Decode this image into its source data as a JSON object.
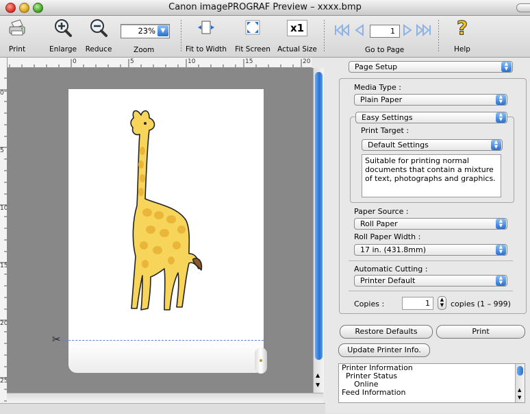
{
  "window": {
    "title": "Canon imagePROGRAF Preview – xxxx.bmp"
  },
  "toolbar": {
    "print_label": "Print",
    "enlarge_label": "Enlarge",
    "reduce_label": "Reduce",
    "zoom_label": "Zoom",
    "zoom_value": "23%",
    "fit_width_label": "Fit to Width",
    "fit_screen_label": "Fit Screen",
    "actual_size_label": "Actual Size",
    "actual_size_glyph": "x1",
    "goto_label": "Go to Page",
    "page_value": "1",
    "help_label": "Help"
  },
  "ruler": {
    "h_numbers": [
      "0",
      "5",
      "10",
      "15",
      "20"
    ],
    "v_numbers": [
      "0",
      "5",
      "10",
      "15",
      "20",
      "25"
    ]
  },
  "panel": {
    "page_setup": "Page Setup",
    "media_type_label": "Media Type :",
    "media_type_value": "Plain Paper",
    "easy_settings": "Easy Settings",
    "print_target_label": "Print Target :",
    "print_target_value": "Default Settings",
    "description": "Suitable for printing normal documents that contain a mixture of text, photographs and graphics.",
    "paper_source_label": "Paper Source :",
    "paper_source_value": "Roll Paper",
    "roll_width_label": "Roll Paper Width :",
    "roll_width_value": "17 in. (431.8mm)",
    "auto_cutting_label": "Automatic Cutting :",
    "auto_cutting_value": "Printer Default",
    "copies_label": "Copies :",
    "copies_value": "1",
    "copies_range": "copies (1 – 999)",
    "restore_defaults": "Restore Defaults",
    "print_button": "Print",
    "update_printer_info": "Update Printer Info.",
    "info_lines": [
      "Printer Information",
      "Printer Status",
      "Online",
      "Feed Information"
    ]
  },
  "colors": {
    "accent": "#2c6fcc",
    "canvas": "#888888",
    "giraffe": "#f6d55a",
    "giraffe_spots": "#e9b63a",
    "cut_line": "#5b7fd6"
  }
}
